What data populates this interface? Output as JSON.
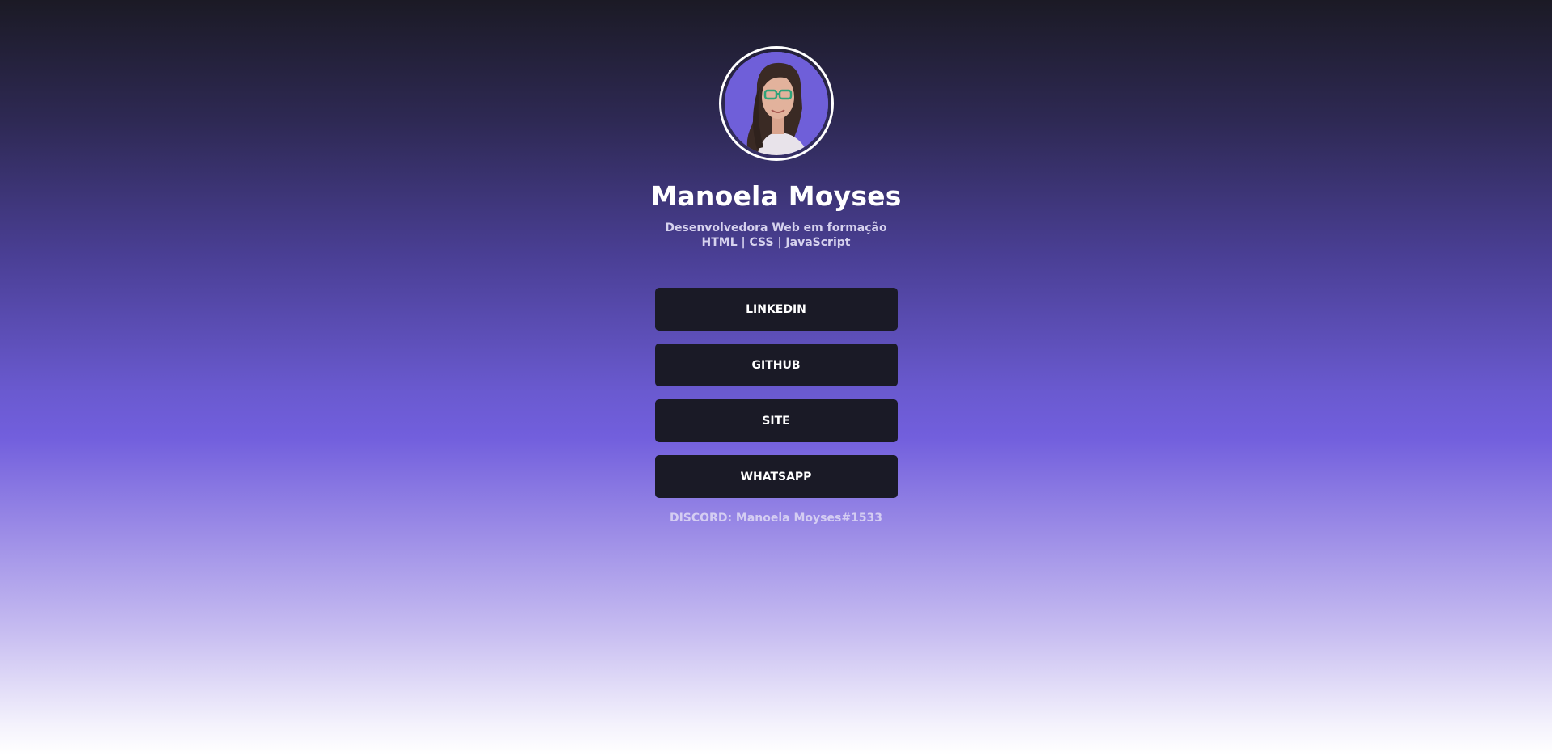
{
  "profile": {
    "name": "Manoela Moyses",
    "bio_line1": "Desenvolvedora Web em formação",
    "bio_line2": "HTML | CSS | JavaScript",
    "avatar_alt": "profile photo",
    "avatar_bg": "#6f5fd9"
  },
  "links": [
    {
      "label": "LINKEDIN"
    },
    {
      "label": "GITHUB"
    },
    {
      "label": "SITE"
    },
    {
      "label": "WHATSAPP"
    }
  ],
  "discord": "DISCORD: Manoela Moyses#1533",
  "colors": {
    "button_bg": "#1a1a26",
    "accent": "#725fdd"
  }
}
